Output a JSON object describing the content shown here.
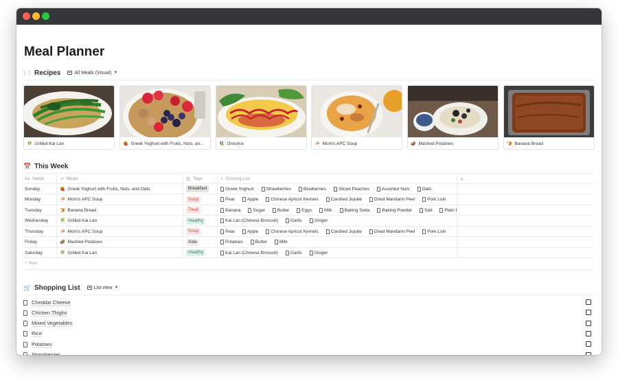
{
  "page": {
    "title": "Meal Planner"
  },
  "recipes": {
    "icon": "🍽️",
    "title": "Recipes",
    "view_label": "All Meals (Visual)",
    "cards": [
      {
        "name": "Grilled Kai Lan",
        "emoji": "🥬"
      },
      {
        "name": "Greek Yoghurt with Fruits, Nuts, an...",
        "emoji": "🍓"
      },
      {
        "name": "Omurice",
        "emoji": "🍳"
      },
      {
        "name": "Mom's APC Soup",
        "emoji": "🍜"
      },
      {
        "name": "Mashed Potatoes",
        "emoji": "🥔"
      },
      {
        "name": "Banana Bread",
        "emoji": "🍞"
      }
    ]
  },
  "this_week": {
    "icon": "📅",
    "title": "This Week",
    "columns": {
      "name": "Name",
      "meals": "Meals",
      "tags": "Tags",
      "grocery": "Grocery List",
      "add": "+"
    },
    "rows": [
      {
        "day": "Sunday",
        "meal": "Greek Yoghurt with Fruits, Nuts, and Oats",
        "emoji": "🍓",
        "tag": "Breakfast",
        "tag_bg": "#e3e2e0",
        "tag_fg": "#37352f",
        "grocery": [
          "Greek Yoghurt",
          "Strawberries",
          "Blueberries",
          "Sliced Peaches",
          "Assorted Nuts",
          "Oats"
        ]
      },
      {
        "day": "Monday",
        "meal": "Mom's APC Soup",
        "emoji": "🍜",
        "tag": "Soup",
        "tag_bg": "#fbe4e4",
        "tag_fg": "#c4554d",
        "grocery": [
          "Pear",
          "Apple",
          "Chinese Apricot Kernels",
          "Candied Jujube",
          "Dried Mandarin Peel",
          "Pork Loin"
        ]
      },
      {
        "day": "Tuesday",
        "meal": "Banana Bread",
        "emoji": "🍞",
        "tag": "Treat",
        "tag_bg": "#fbe4e4",
        "tag_fg": "#c4554d",
        "grocery": [
          "Banana",
          "Sugar",
          "Butter",
          "Eggs",
          "Milk",
          "Baking Soda",
          "Baking Powder",
          "Salt",
          "Plain F"
        ]
      },
      {
        "day": "Wednesday",
        "meal": "Grilled Kai Lan",
        "emoji": "🥬",
        "tag": "Healthy",
        "tag_bg": "#ddedea",
        "tag_fg": "#448361",
        "grocery": [
          "Kai Lan (Chinese Broccoli)",
          "Garlic",
          "Ginger"
        ]
      },
      {
        "day": "Thursday",
        "meal": "Mom's APC Soup",
        "emoji": "🍜",
        "tag": "Soup",
        "tag_bg": "#fbe4e4",
        "tag_fg": "#c4554d",
        "grocery": [
          "Pear",
          "Apple",
          "Chinese Apricot Kernels",
          "Candied Jujube",
          "Dried Mandarin Peel",
          "Pork Loin"
        ]
      },
      {
        "day": "Friday",
        "meal": "Mashed Potatoes",
        "emoji": "🥔",
        "tag": "Side",
        "tag_bg": "#eeeeed",
        "tag_fg": "#37352f",
        "grocery": [
          "Potatoes",
          "Butter",
          "Milk"
        ]
      },
      {
        "day": "Saturday",
        "meal": "Grilled Kai Lan",
        "emoji": "🥬",
        "tag": "Healthy",
        "tag_bg": "#ddedea",
        "tag_fg": "#448361",
        "grocery": [
          "Kai Lan (Chinese Broccoli)",
          "Garlic",
          "Ginger"
        ]
      }
    ],
    "new_label": "+ New"
  },
  "shopping_list": {
    "icon": "🛒",
    "title": "Shopping List",
    "view_label": "List view",
    "items": [
      "Cheddar Cheese",
      "Chicken Thighs",
      "Mixed Vegetables",
      "Rice",
      "Potatoes",
      "Strawberries"
    ]
  }
}
